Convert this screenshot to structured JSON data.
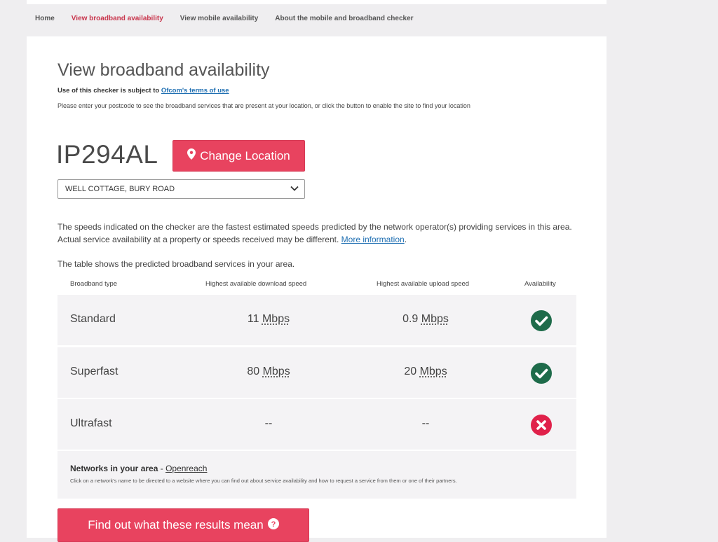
{
  "nav": {
    "items": [
      {
        "label": "Home",
        "active": false
      },
      {
        "label": "View broadband availability",
        "active": true
      },
      {
        "label": "View mobile availability",
        "active": false
      },
      {
        "label": "About the mobile and broadband checker",
        "active": false
      }
    ]
  },
  "page": {
    "title": "View broadband availability",
    "terms_prefix": "Use of this checker is subject to ",
    "terms_link": "Ofcom's terms of use",
    "instruction": "Please enter your postcode to see the broadband services that are present at your location, or click the button to enable the site to find your location"
  },
  "location": {
    "postcode": "IP294AL",
    "change_button": "Change Location",
    "button_icon": "map-marker-icon",
    "address": "WELL COTTAGE, BURY ROAD"
  },
  "info": {
    "speeds_text": "The speeds indicated on the checker are the fastest estimated speeds predicted by the network operator(s) providing services in this area. Actual service availability at a property or speeds received may be different. ",
    "more_link": "More information",
    "period": ".",
    "table_intro": "The table shows the predicted broadband services in your area."
  },
  "table": {
    "headers": [
      "Broadband type",
      "Highest available download speed",
      "Highest available upload speed",
      "Availability"
    ],
    "rows": [
      {
        "type": "Standard",
        "down_value": "11",
        "down_unit": "Mbps",
        "up_value": "0.9",
        "up_unit": "Mbps",
        "available": true
      },
      {
        "type": "Superfast",
        "down_value": "80",
        "down_unit": "Mbps",
        "up_value": "20",
        "up_unit": "Mbps",
        "available": true
      },
      {
        "type": "Ultrafast",
        "down_value": "--",
        "down_unit": "",
        "up_value": "--",
        "up_unit": "",
        "available": false
      }
    ]
  },
  "networks": {
    "label": "Networks in your area",
    "separator": " - ",
    "operator": "Openreach",
    "note": "Click on a network's name to be directed to a website where you can find out about service availability and how to request a service from them or one of their partners."
  },
  "results_button": {
    "label": "Find out what these results mean",
    "icon": "question-circle-icon"
  },
  "colors": {
    "accent": "#e8435f",
    "active_nav": "#c8344b",
    "available": "#1e6b4a",
    "unavailable": "#e0214a",
    "link": "#1f6fb2"
  }
}
